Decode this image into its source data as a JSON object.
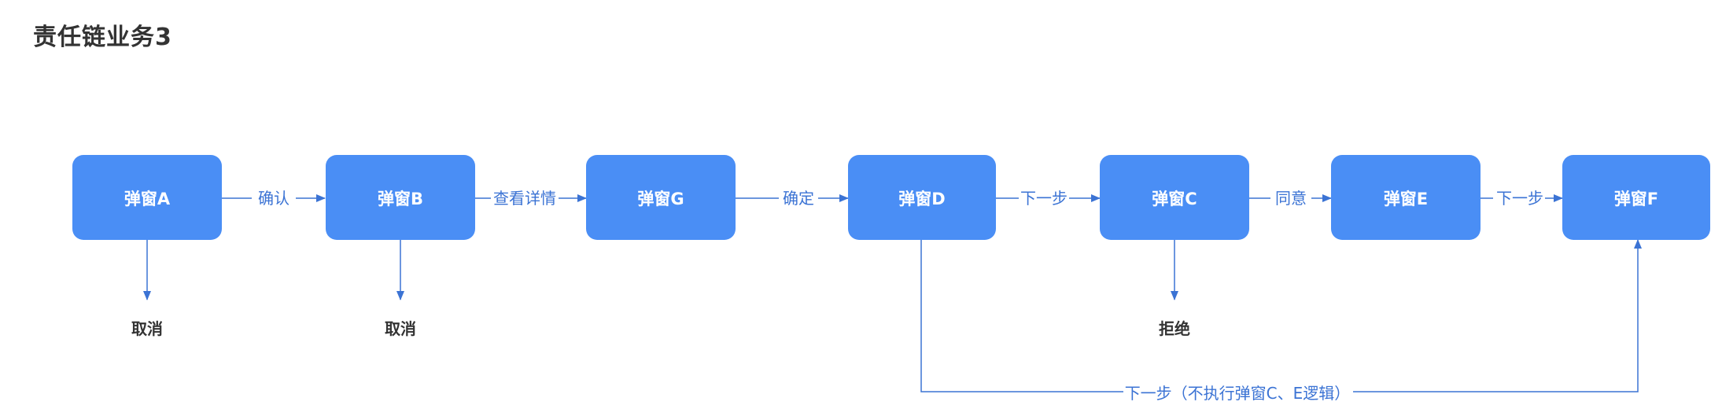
{
  "title": "责任链业务3",
  "colors": {
    "node": "#4a8ef5",
    "edge": "#3b73d4",
    "text": "#333333"
  },
  "nodes": [
    {
      "id": "A",
      "label": "弹窗A"
    },
    {
      "id": "B",
      "label": "弹窗B"
    },
    {
      "id": "G",
      "label": "弹窗G"
    },
    {
      "id": "D",
      "label": "弹窗D"
    },
    {
      "id": "C",
      "label": "弹窗C"
    },
    {
      "id": "E",
      "label": "弹窗E"
    },
    {
      "id": "F",
      "label": "弹窗F"
    }
  ],
  "edges": [
    {
      "from": "A",
      "to": "B",
      "label": "确认"
    },
    {
      "from": "B",
      "to": "G",
      "label": "查看详情"
    },
    {
      "from": "G",
      "to": "D",
      "label": "确定"
    },
    {
      "from": "D",
      "to": "C",
      "label": "下一步"
    },
    {
      "from": "C",
      "to": "E",
      "label": "同意"
    },
    {
      "from": "E",
      "to": "F",
      "label": "下一步"
    },
    {
      "from": "D",
      "to": "F",
      "label": "下一步（不执行弹窗C、E逻辑）"
    }
  ],
  "endpoints": [
    {
      "from": "A",
      "label": "取消"
    },
    {
      "from": "B",
      "label": "取消"
    },
    {
      "from": "C",
      "label": "拒绝"
    }
  ]
}
